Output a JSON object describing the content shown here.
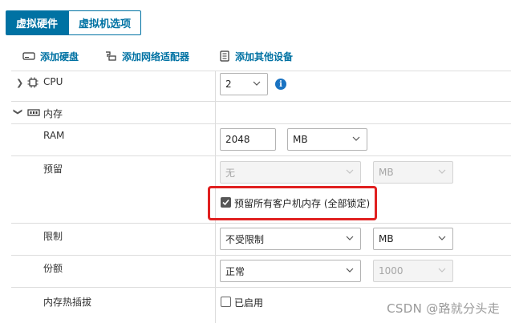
{
  "tabs": [
    {
      "label": "虚拟硬件"
    },
    {
      "label": "虚拟机选项"
    }
  ],
  "toolbar": {
    "add_disk": "添加硬盘",
    "add_network": "添加网络适配器",
    "add_other": "添加其他设备"
  },
  "cpu": {
    "label": "CPU",
    "value": "2",
    "info_icon": "info-icon"
  },
  "memory": {
    "label": "内存",
    "ram_label": "RAM",
    "ram_value": "2048",
    "ram_unit": "MB",
    "reservation_label": "预留",
    "reservation_value": "无",
    "reservation_unit": "MB",
    "reserve_all_label": "预留所有客户机内存 (全部锁定)",
    "reserve_all_checked": true,
    "limit_label": "限制",
    "limit_value": "不受限制",
    "limit_unit": "MB",
    "shares_label": "份额",
    "shares_value": "正常",
    "shares_number": "1000",
    "hotplug_label": "内存热插拔",
    "hotplug_option": "已启用",
    "hotplug_checked": false
  },
  "watermark": "CSDN @路就分头走",
  "colors": {
    "accent": "#0072a3",
    "highlight": "#e02020",
    "info": "#1a73c2"
  }
}
